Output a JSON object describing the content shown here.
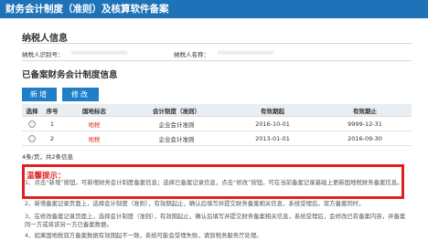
{
  "window": {
    "title": "财务会计制度（准则）及核算软件备案"
  },
  "taxpayer": {
    "section_title": "纳税人信息",
    "id_label": "纳税人识别号：",
    "id_value": "••••••••••••••••",
    "name_label": "纳税人名称：",
    "name_value": "••••••••••••••••"
  },
  "records": {
    "section_title": "已备案财务会计制度信息",
    "add_label": "新增",
    "edit_label": "修改",
    "columns": [
      "选择",
      "序号",
      "国地标志",
      "会计制度（准则）",
      "有效期起",
      "有效期止"
    ],
    "rows": [
      {
        "index": "1",
        "region": "地税",
        "system": "企业会计准则",
        "start": "2016-10-01",
        "end": "9999-12-31"
      },
      {
        "index": "2",
        "region": "地税",
        "system": "企业会计准则",
        "start": "2013-01-01",
        "end": "2016-09-30"
      }
    ],
    "pager": "4条/页，共2条信息"
  },
  "notice": {
    "title": "温馨提示：",
    "tips": [
      "1、点击“新增”按钮，可新增财务会计制度备案信息；选择已备案记录信息，点击“修改”按钮，可在当前备案记录基础上更新国地税财务备案信息。",
      "2、新增备案记录页面上，选择会计制度（准则），有效期起止，确认后填写并提交财务备案相关信息，系统受理后，双方备案同时，",
      "3、在修改备案记录页面上，选择会计制度（准则），有效期起止，确认后填写并提交财务备案相关信息，系统受理后，会修改已有备案内容，并备案同一方或将该另一方已备案数据。",
      "4、如果国地税双方备案数据有效期起不一致，系统可能会受理失败，请到税务服务厅处理。"
    ]
  }
}
